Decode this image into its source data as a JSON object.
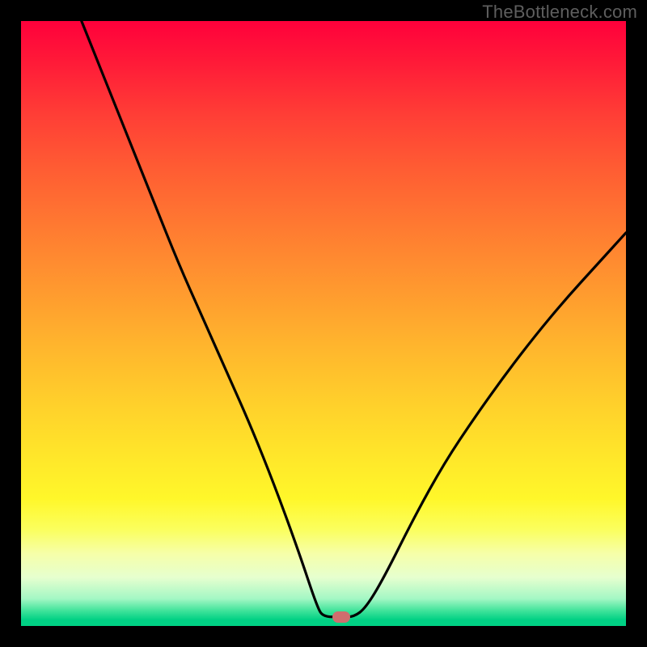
{
  "watermark": "TheBottleneck.com",
  "colors": {
    "frame_bg": "#000000",
    "watermark_text": "#5e5e5e",
    "marker_fill": "#cf6e6e",
    "curve_stroke": "#000000",
    "gradient_stops": [
      {
        "offset": 0.0,
        "color": "#ff003b"
      },
      {
        "offset": 0.15,
        "color": "#ff3c36"
      },
      {
        "offset": 0.34,
        "color": "#ff7a31"
      },
      {
        "offset": 0.54,
        "color": "#ffb62d"
      },
      {
        "offset": 0.73,
        "color": "#ffe92a"
      },
      {
        "offset": 0.88,
        "color": "#f6ffa8"
      },
      {
        "offset": 0.97,
        "color": "#3fe39a"
      },
      {
        "offset": 1.0,
        "color": "#00d184"
      }
    ]
  },
  "chart_data": {
    "type": "line",
    "title": "",
    "xlabel": "",
    "ylabel": "",
    "xlim": [
      0,
      100
    ],
    "ylim": [
      0,
      100
    ],
    "marker": {
      "x": 53,
      "y": 1.5
    },
    "series": [
      {
        "name": "bottleneck-curve",
        "points": [
          {
            "x": 10.0,
            "y": 100.0
          },
          {
            "x": 14.0,
            "y": 90.0
          },
          {
            "x": 18.0,
            "y": 80.0
          },
          {
            "x": 22.0,
            "y": 70.0
          },
          {
            "x": 26.0,
            "y": 60.0
          },
          {
            "x": 30.0,
            "y": 51.0
          },
          {
            "x": 34.0,
            "y": 42.0
          },
          {
            "x": 38.0,
            "y": 33.0
          },
          {
            "x": 42.0,
            "y": 23.0
          },
          {
            "x": 46.0,
            "y": 12.0
          },
          {
            "x": 49.0,
            "y": 3.0
          },
          {
            "x": 50.0,
            "y": 1.5
          },
          {
            "x": 53.0,
            "y": 1.5
          },
          {
            "x": 55.0,
            "y": 1.5
          },
          {
            "x": 57.0,
            "y": 3.0
          },
          {
            "x": 60.0,
            "y": 8.0
          },
          {
            "x": 65.0,
            "y": 18.0
          },
          {
            "x": 70.0,
            "y": 27.0
          },
          {
            "x": 75.0,
            "y": 34.5
          },
          {
            "x": 80.0,
            "y": 41.5
          },
          {
            "x": 85.0,
            "y": 48.0
          },
          {
            "x": 90.0,
            "y": 54.0
          },
          {
            "x": 95.0,
            "y": 59.5
          },
          {
            "x": 100.0,
            "y": 65.0
          }
        ]
      }
    ]
  }
}
